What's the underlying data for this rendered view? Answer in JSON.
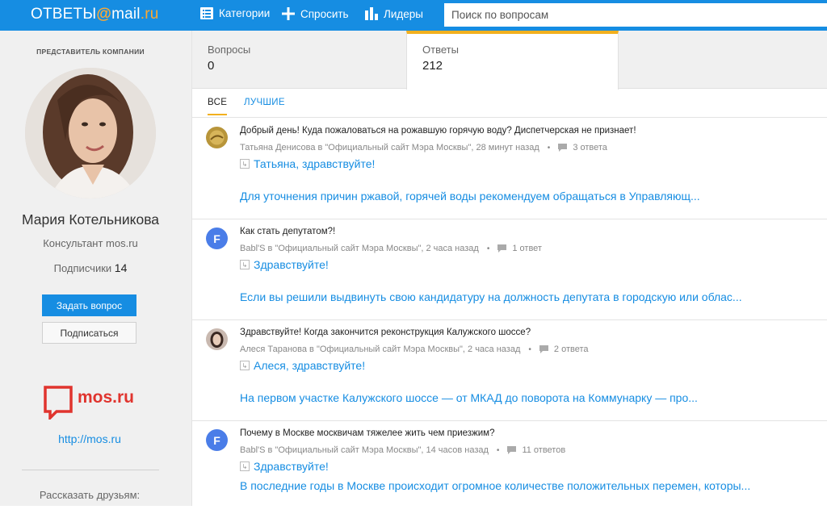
{
  "header": {
    "logo_main": "ОТВЕТЫ",
    "logo_at": "@",
    "logo_mail": "mail",
    "logo_dot": ".",
    "logo_ru": "ru",
    "nav": [
      {
        "label": "Категории",
        "icon": "list-icon"
      },
      {
        "label": "Спросить",
        "icon": "plus-icon"
      },
      {
        "label": "Лидеры",
        "icon": "bar-chart-icon"
      }
    ],
    "search_placeholder": "Поиск по вопросам"
  },
  "sidebar": {
    "rep_label": "ПРЕДСТАВИТЕЛЬ КОМПАНИИ",
    "name": "Мария Котельникова",
    "role": "Консультант mos.ru",
    "subscribers_label": "Подписчики",
    "subscribers_count": "14",
    "ask_button": "Задать вопрос",
    "subscribe_button": "Подписаться",
    "brand_logo_text": "mos.ru",
    "link": "http://mos.ru",
    "share_label": "Рассказать друзьям:"
  },
  "stats": {
    "questions_label": "Вопросы",
    "questions_count": "0",
    "answers_label": "Ответы",
    "answers_count": "212"
  },
  "tabs": {
    "all": "ВСЕ",
    "best": "ЛУЧШИЕ"
  },
  "questions": [
    {
      "avatar": "photo",
      "title": "Добрый день! Куда пожаловаться на рожавшую горячую воду? Диспетчерская не признает!",
      "meta": "Татьяна Денисова в \"Официальный сайт Мэра Москвы\", 28 минут назад",
      "answers": "3 ответа",
      "reply": "Татьяна, здравствуйте!",
      "answer": "Для уточнения причин ржавой, горячей воды рекомендуем обращаться в Управляющ..."
    },
    {
      "avatar": "F",
      "title": "Как стать депутатом?!",
      "meta": "Babl'S в \"Официальный сайт Мэра Москвы\", 2 часа назад",
      "answers": "1 ответ",
      "reply": "Здравствуйте!",
      "answer": "Если вы решили выдвинуть свою кандидатуру на должность депутата в городскую или облас..."
    },
    {
      "avatar": "photo",
      "title": "Здравствуйте! Когда закончится реконструкция Калужского шоссе?",
      "meta": "Алеся Таранова в \"Официальный сайт Мэра Москвы\", 2 часа назад",
      "answers": "2 ответа",
      "reply": "Алеся, здравствуйте!",
      "answer": "На первом участке Калужского шоссе — от МКАД до поворота на Коммунарку — про..."
    },
    {
      "avatar": "F",
      "title": "Почему в Москве москвичам тяжелее жить чем приезжим?",
      "meta": "Babl'S в \"Официальный сайт Мэра Москвы\", 14 часов назад",
      "answers": "11 ответов",
      "reply": "Здравствуйте!",
      "answer": "В последние годы в Москве происходит огромное количестве положительных перемен, которы..."
    }
  ]
}
